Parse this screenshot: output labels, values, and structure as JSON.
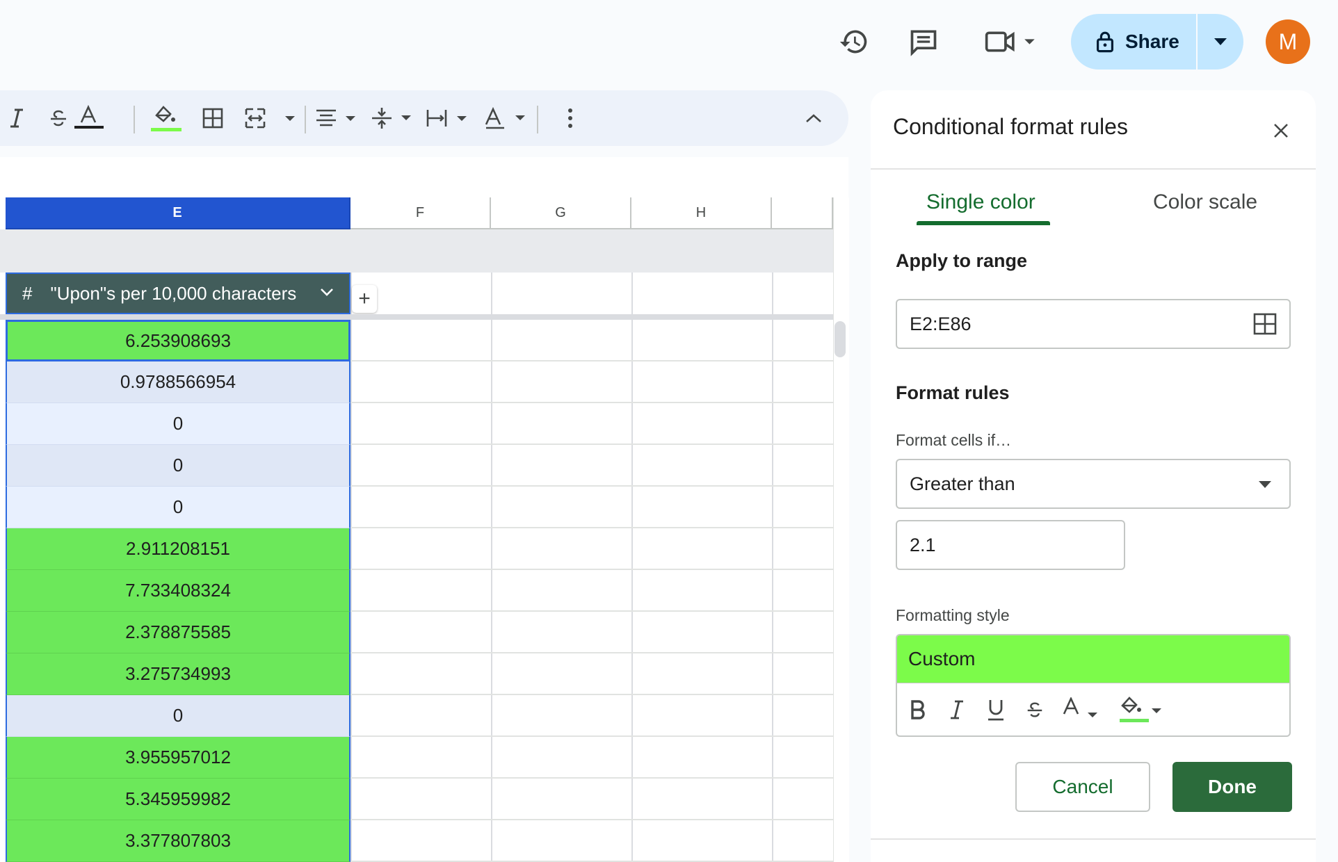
{
  "topbar": {
    "icons": [
      "history-icon",
      "comment-icon",
      "video-camera-icon"
    ],
    "share_label": "Share",
    "avatar_letter": "M"
  },
  "toolbar": {
    "icons": [
      "italic-icon",
      "strikethrough-icon",
      "text-color-icon",
      "fill-color-icon",
      "borders-icon",
      "merge-cells-icon",
      "horizontal-align-icon",
      "vertical-align-icon",
      "text-wrap-icon",
      "text-rotation-icon",
      "more-options-icon",
      "collapse-toolbar-icon"
    ]
  },
  "sheet": {
    "columns": [
      "E",
      "F",
      "G",
      "H"
    ],
    "selected_column": "E",
    "table_header": {
      "type_icon": "#",
      "label": "\"Upon\"s per 10,000 characters"
    },
    "add_column": "+",
    "rows": [
      {
        "value": "6.253908693",
        "highlight": true
      },
      {
        "value": "0.9788566954",
        "highlight": false
      },
      {
        "value": "0",
        "highlight": false
      },
      {
        "value": "0",
        "highlight": false
      },
      {
        "value": "0",
        "highlight": false
      },
      {
        "value": "2.911208151",
        "highlight": true
      },
      {
        "value": "7.733408324",
        "highlight": true
      },
      {
        "value": "2.378875585",
        "highlight": true
      },
      {
        "value": "3.275734993",
        "highlight": true
      },
      {
        "value": "0",
        "highlight": false
      },
      {
        "value": "3.955957012",
        "highlight": true
      },
      {
        "value": "5.345959982",
        "highlight": true
      },
      {
        "value": "3.377807803",
        "highlight": true
      }
    ],
    "highlight_color": "#6ce85a"
  },
  "panel": {
    "title": "Conditional format rules",
    "tabs": [
      "Single color",
      "Color scale"
    ],
    "active_tab": "Single color",
    "apply_to_range_label": "Apply to range",
    "range_value": "E2:E86",
    "format_rules_label": "Format rules",
    "format_cells_if_label": "Format cells if…",
    "condition": "Greater than",
    "condition_value": "2.1",
    "formatting_style_label": "Formatting style",
    "style_preview": "Custom",
    "style_fill_color": "#7cfb4a",
    "style_buttons": [
      "bold-icon",
      "italic-icon",
      "underline-icon",
      "strikethrough-icon",
      "text-color-icon",
      "fill-color-icon"
    ],
    "cancel_label": "Cancel",
    "done_label": "Done",
    "accent_color": "#146c2e"
  }
}
